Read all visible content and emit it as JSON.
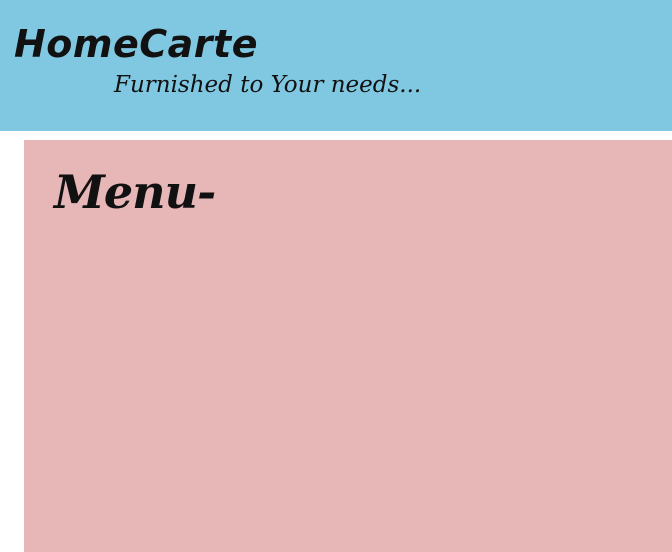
{
  "header": {
    "title": "HomeCarte",
    "tagline": "Furnished to Your needs...",
    "background_color": "#80c8e2"
  },
  "menu": {
    "heading": "Menu-",
    "background_color": "#e7b6b7"
  }
}
